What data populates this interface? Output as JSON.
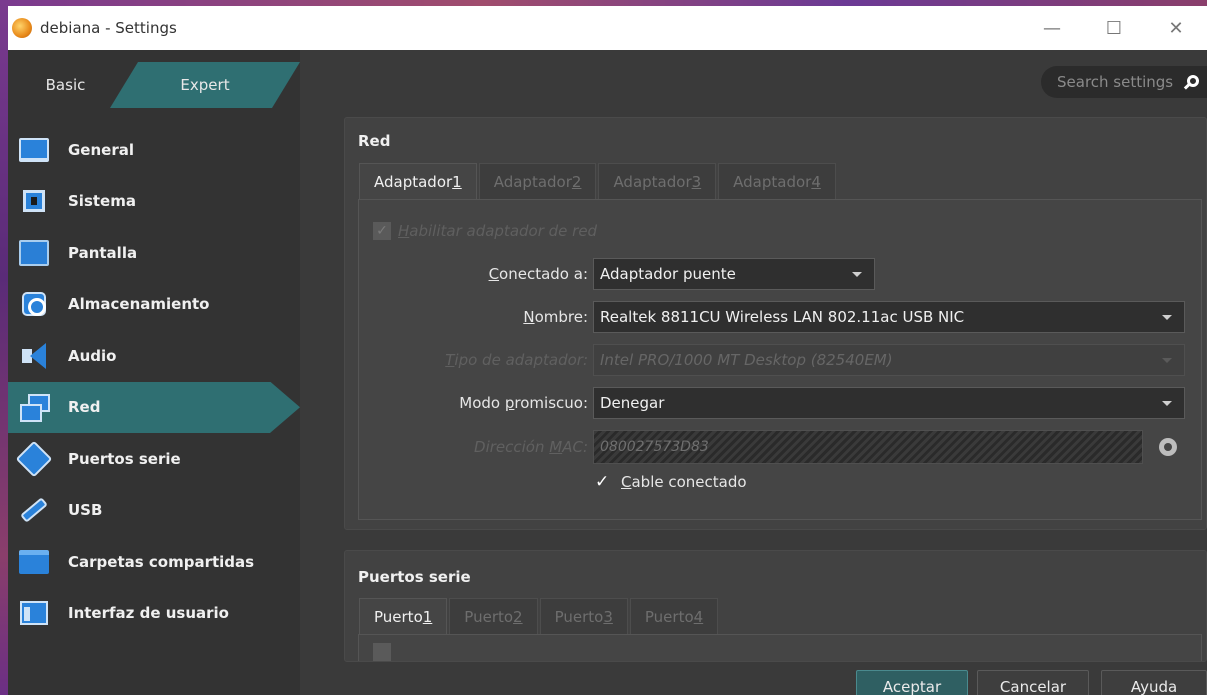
{
  "window": {
    "title": "debiana - Settings",
    "controls": {
      "minimize": "—",
      "maximize": "☐",
      "close": "✕"
    }
  },
  "mode_tabs": {
    "basic": "Basic",
    "expert": "Expert"
  },
  "search": {
    "placeholder": "Search settings"
  },
  "sidebar": {
    "items": [
      {
        "label": "General",
        "icon": "monitor-icon"
      },
      {
        "label": "Sistema",
        "icon": "chip-icon"
      },
      {
        "label": "Pantalla",
        "icon": "screen-icon"
      },
      {
        "label": "Almacenamiento",
        "icon": "disk-icon"
      },
      {
        "label": "Audio",
        "icon": "speaker-icon"
      },
      {
        "label": "Red",
        "icon": "network-icon",
        "active": true
      },
      {
        "label": "Puertos serie",
        "icon": "serial-port-icon"
      },
      {
        "label": "USB",
        "icon": "usb-icon"
      },
      {
        "label": "Carpetas compartidas",
        "icon": "folder-icon"
      },
      {
        "label": "Interfaz de usuario",
        "icon": "user-interface-icon"
      }
    ]
  },
  "red": {
    "title": "Red",
    "tabs": [
      {
        "text": "Adaptador ",
        "key": "1",
        "active": true
      },
      {
        "text": "Adaptador ",
        "key": "2"
      },
      {
        "text": "Adaptador ",
        "key": "3"
      },
      {
        "text": "Adaptador ",
        "key": "4"
      }
    ],
    "enable_adapter": {
      "pre": "",
      "key": "H",
      "post": "abilitar adaptador de red",
      "checked": true,
      "enabled": false
    },
    "attached_to": {
      "pre": "",
      "key": "C",
      "post": "onectado a:",
      "value": "Adaptador puente"
    },
    "name": {
      "pre": "",
      "key": "N",
      "post": "ombre:",
      "value": "Realtek 8811CU Wireless LAN 802.11ac USB NIC"
    },
    "adapter_type": {
      "pre": "",
      "key": "T",
      "post": "ipo de adaptador:",
      "value": "Intel PRO/1000 MT Desktop (82540EM)"
    },
    "promiscuous": {
      "pre": "Modo ",
      "key": "p",
      "post": "romiscuo:",
      "value": "Denegar"
    },
    "mac": {
      "pre": "Dirección ",
      "key": "M",
      "post": "AC:",
      "value": "080027573D83"
    },
    "cable": {
      "pre": "",
      "key": "C",
      "post": "able conectado",
      "checked": true
    }
  },
  "serial": {
    "title": "Puertos serie",
    "tabs": [
      {
        "text": "Puerto ",
        "key": "1",
        "active": true
      },
      {
        "text": "Puerto ",
        "key": "2"
      },
      {
        "text": "Puerto ",
        "key": "3"
      },
      {
        "text": "Puerto ",
        "key": "4"
      }
    ]
  },
  "buttons": {
    "ok": "Aceptar",
    "cancel": "Cancelar",
    "help": "Ayuda"
  },
  "colors": {
    "accent": "#2f6f72",
    "icon_blue": "#2a82da"
  }
}
